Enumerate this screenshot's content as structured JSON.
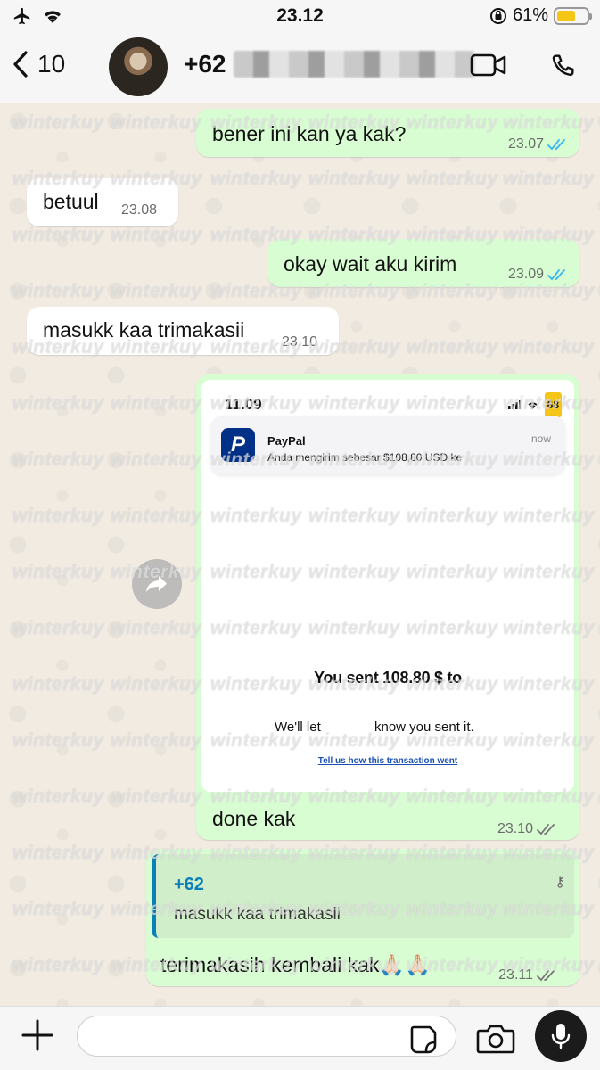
{
  "status_bar": {
    "time": "23.12",
    "battery_percent": "61%",
    "battery_level": 0.61
  },
  "header": {
    "back_count": "10",
    "contact_prefix": "+62"
  },
  "messages": [
    {
      "text": "bener ini kan ya kak?",
      "time": "23.07",
      "direction": "out",
      "status": "read"
    },
    {
      "text": "betuul",
      "time": "23.08",
      "direction": "in"
    },
    {
      "text": "okay wait aku kirim",
      "time": "23.09",
      "direction": "out",
      "status": "read"
    },
    {
      "text": "masukk kaa trimakasii",
      "time": "23.10",
      "direction": "in"
    },
    {
      "direction": "out",
      "type": "image",
      "caption": "done kak",
      "time": "23.10",
      "status": "delivered",
      "image": {
        "phone_time": "11.09",
        "phone_battery": "68",
        "notification_app": "PayPal",
        "notification_body": "Anda mengirim sebesar $108,80 USD ke",
        "notification_time": "now",
        "sent_title": "You sent 108.80 $ to",
        "sent_sub_a": "We'll let",
        "sent_sub_b": "know you sent it.",
        "tell_link": "Tell us how this transaction went"
      }
    },
    {
      "direction": "out",
      "type": "reply",
      "quoted_sender": "+62",
      "quoted_text": "masukk kaa trimakasii",
      "text": "terimakasih kembali kak🙏🏻🙏🏻",
      "time": "23.11",
      "status": "delivered"
    }
  ],
  "watermark": "winterkuy",
  "input": {
    "placeholder": ""
  },
  "colors": {
    "outgoing_bubble": "#d9fdd3",
    "incoming_bubble": "#ffffff",
    "read_tick": "#34b7f1",
    "delivered_tick": "#777777",
    "quote_bar": "#0a7fb8"
  }
}
